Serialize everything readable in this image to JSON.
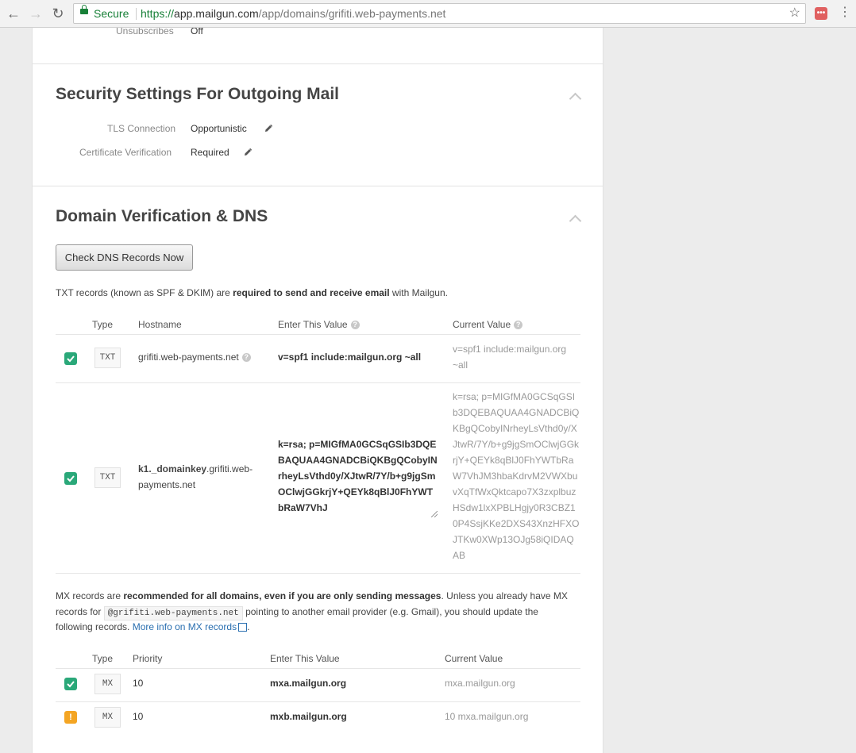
{
  "browser": {
    "secure_label": "Secure",
    "url_scheme": "https://",
    "url_host": "app.mailgun.com",
    "url_path": "/app/domains/grifiti.web-payments.net"
  },
  "top_cut": {
    "label": "Unsubscribes",
    "value": "Off"
  },
  "security": {
    "title": "Security Settings For Outgoing Mail",
    "tls_label": "TLS Connection",
    "tls_value": "Opportunistic",
    "cert_label": "Certificate Verification",
    "cert_value": "Required"
  },
  "dns": {
    "title": "Domain Verification & DNS",
    "check_button": "Check DNS Records Now",
    "txt_intro_pre": "TXT records (known as SPF & DKIM) are ",
    "txt_intro_bold": "required to send and receive email",
    "txt_intro_post": " with Mailgun.",
    "txt_headers": {
      "type": "Type",
      "hostname": "Hostname",
      "enter": "Enter This Value",
      "current": "Current Value"
    },
    "txt_rows": [
      {
        "type": "TXT",
        "hostname": "grifiti.web-payments.net",
        "enter": "v=spf1 include:mailgun.org ~all",
        "current_line1": "v=spf1 include:mailgun.org",
        "current_line2": "~all"
      },
      {
        "type": "TXT",
        "hostname_bold": "k1._domainkey",
        "hostname_rest_1": ".grifiti.web-",
        "hostname_rest_2": "payments.net",
        "enter": "k=rsa; p=MIGfMA0GCSqGSIb3DQEBAQUAA4GNADCBiQKBgQCobyINrheyLsVthd0y/XJtwR/7Y/b+g9jgSmOClwjGGkrjY+QEYk8qBlJ0FhYWTbRaW7VhJ",
        "current": "k=rsa; p=MIGfMA0GCSqGSIb3DQEBAQUAA4GNADCBiQKBgQCobyINrheyLsVthd0y/XJtwR/7Y/b+g9jgSmOClwjGGkrjY+QEYk8qBlJ0FhYWTbRaW7VhJM3hbaKdrvM2VWXbuvXqTfWxQktcapo7X3zxplbuzHSdw1lxXPBLHgjy0R3CBZ10P4SsjKKe2DXS43XnzHFXOJTKw0XWp13OJg58iQIDAQAB"
      }
    ],
    "mx_para_1": "MX records are ",
    "mx_para_bold": "recommended for all domains, even if you are only sending messages",
    "mx_para_2": ". Unless you already have MX",
    "mx_para_3": "records for",
    "mx_para_code": "@grifiti.web-payments.net",
    "mx_para_4": "pointing to another email provider (e.g. Gmail), you should update the",
    "mx_para_5": "following records.",
    "mx_link": "More info on MX records",
    "mx_headers": {
      "type": "Type",
      "priority": "Priority",
      "enter": "Enter This Value",
      "current": "Current Value"
    },
    "mx_rows": [
      {
        "status": "ok",
        "type": "MX",
        "priority": "10",
        "enter": "mxa.mailgun.org",
        "current": "mxa.mailgun.org"
      },
      {
        "status": "warning",
        "type": "MX",
        "priority": "10",
        "enter": "mxb.mailgun.org",
        "current": "10 mxa.mailgun.org"
      }
    ]
  }
}
